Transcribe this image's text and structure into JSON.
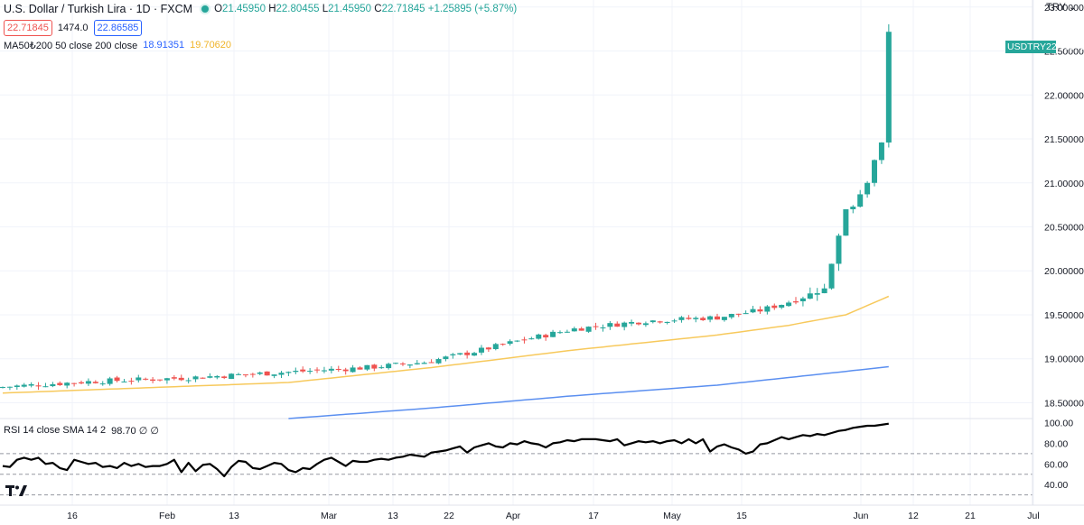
{
  "header": {
    "title": "U.S. Dollar / Turkish Lira · 1D · FXCM",
    "ohlc": {
      "open_label": "O",
      "open": "21.45950",
      "high_label": "H",
      "high": "22.80455",
      "low_label": "L",
      "low": "21.45950",
      "close_label": "C",
      "close": "22.71845",
      "change": "+1.25895 (+5.87%)"
    },
    "sell_price": "22.71845",
    "spread": "1474.0",
    "buy_price": "22.86585",
    "ma_label": "MA50₺200 50 close 200 close",
    "ma50_value": "18.91351",
    "ma200_value": "19.70620",
    "rsi_label": "RSI 14 close SMA 14 2",
    "rsi_values": "98.70 ∅ ∅",
    "currency": "TRY",
    "symbol_tag": "USDTRY",
    "last_price": "22.71845"
  },
  "colors": {
    "up": "#26a69a",
    "down": "#ef5350",
    "ma50": "#5b8ff0",
    "ma200": "#f7c95c",
    "rsi": "#000000",
    "grid": "#f0f3fa"
  },
  "chart_data": [
    {
      "type": "candlestick",
      "title": "U.S. Dollar / Turkish Lira · 1D · FXCM",
      "x_tick_labels": [
        "16",
        "Feb",
        "13",
        "Mar",
        "13",
        "22",
        "Apr",
        "17",
        "May",
        "15",
        "Jun",
        "12",
        "21",
        "Jul"
      ],
      "y_tick_labels": [
        "23.00000",
        "22.50000",
        "22.00000",
        "21.50000",
        "21.00000",
        "20.50000",
        "20.00000",
        "19.50000",
        "19.00000",
        "18.50000"
      ],
      "ylim": [
        18.32,
        23.08
      ],
      "grid": true,
      "close_key_points": [
        [
          0,
          18.68
        ],
        [
          12,
          18.74
        ],
        [
          25,
          18.78
        ],
        [
          38,
          18.84
        ],
        [
          51,
          18.9
        ],
        [
          59,
          18.96
        ],
        [
          66,
          19.08
        ],
        [
          72,
          19.2
        ],
        [
          80,
          19.34
        ],
        [
          90,
          19.43
        ],
        [
          100,
          19.47
        ],
        [
          106,
          19.55
        ],
        [
          111,
          19.67
        ],
        [
          115,
          19.8
        ],
        [
          116,
          20.08
        ],
        [
          117,
          20.4
        ],
        [
          118,
          20.7
        ],
        [
          119,
          20.73
        ],
        [
          120,
          20.87
        ],
        [
          121,
          21.0
        ],
        [
          122,
          21.26
        ],
        [
          123,
          21.46
        ],
        [
          124,
          22.72
        ]
      ],
      "series": [
        {
          "name": "MA 50",
          "key_points": [
            [
              40,
              18.32
            ],
            [
              60,
              18.44
            ],
            [
              80,
              18.58
            ],
            [
              100,
              18.7
            ],
            [
              115,
              18.83
            ],
            [
              124,
              18.91
            ]
          ]
        },
        {
          "name": "MA 200",
          "key_points": [
            [
              0,
              18.61
            ],
            [
              40,
              18.73
            ],
            [
              60,
              18.9
            ],
            [
              80,
              19.1
            ],
            [
              100,
              19.27
            ],
            [
              110,
              19.38
            ],
            [
              118,
              19.5
            ],
            [
              124,
              19.71
            ]
          ]
        }
      ]
    },
    {
      "type": "line",
      "title": "RSI 14 close SMA 14 2",
      "y_tick_labels": [
        "100.00",
        "80.00",
        "60.00",
        "40.00"
      ],
      "ylim": [
        20,
        104
      ],
      "reference_lines": [
        70,
        50,
        30
      ],
      "grid": true,
      "series": [
        {
          "values": [
            58,
            57,
            64,
            66,
            64,
            66,
            60,
            61,
            56,
            54,
            64,
            62,
            60,
            61,
            57,
            58,
            56,
            61,
            58,
            60,
            57,
            58,
            58,
            60,
            64,
            52,
            61,
            53,
            59,
            60,
            55,
            48,
            57,
            63,
            62,
            56,
            55,
            58,
            61,
            60,
            54,
            52,
            56,
            55,
            60,
            64,
            66,
            62,
            58,
            63,
            62,
            62,
            64,
            65,
            64,
            66,
            67,
            69,
            68,
            67,
            71,
            72,
            73,
            75,
            77,
            71,
            76,
            78,
            80,
            77,
            76,
            80,
            79,
            82,
            80,
            79,
            76,
            80,
            81,
            83,
            82,
            84,
            84,
            84,
            83,
            82,
            84,
            78,
            80,
            82,
            81,
            82,
            80,
            82,
            83,
            80,
            84,
            80,
            84,
            72,
            77,
            79,
            76,
            74,
            70,
            72,
            79,
            80,
            83,
            86,
            84,
            86,
            88,
            87,
            89,
            88,
            90,
            92,
            93,
            95,
            96,
            97,
            97,
            98,
            99
          ]
        }
      ]
    }
  ]
}
